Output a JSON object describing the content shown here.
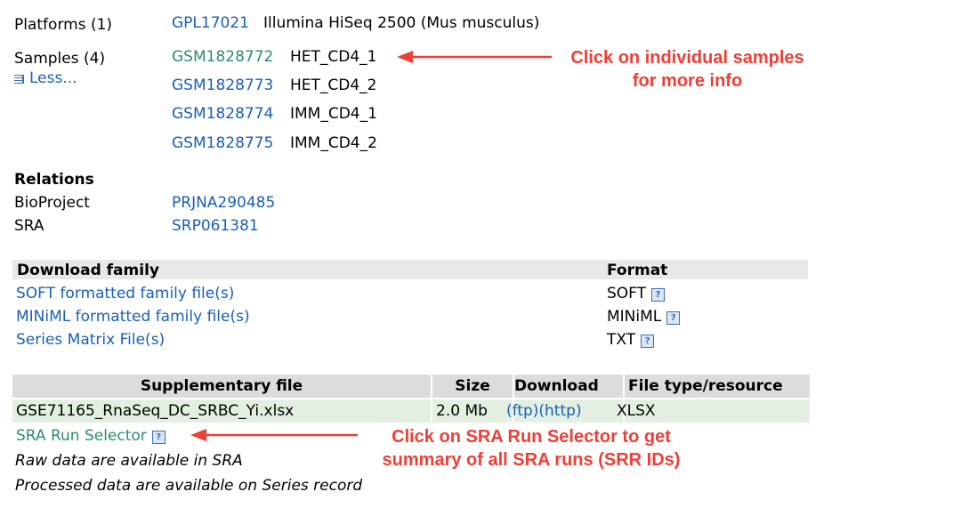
{
  "platforms": {
    "label": "Platforms (1)",
    "id": "GPL17021",
    "desc": "Illumina HiSeq 2500 (Mus musculus)"
  },
  "samples": {
    "label": "Samples (4)",
    "less": "Less...",
    "items": [
      {
        "id": "GSM1828772",
        "name": "HET_CD4_1"
      },
      {
        "id": "GSM1828773",
        "name": "HET_CD4_2"
      },
      {
        "id": "GSM1828774",
        "name": "IMM_CD4_1"
      },
      {
        "id": "GSM1828775",
        "name": "IMM_CD4_2"
      }
    ]
  },
  "relations": {
    "heading": "Relations",
    "bioproject_label": "BioProject",
    "bioproject_id": "PRJNA290485",
    "sra_label": "SRA",
    "sra_id": "SRP061381"
  },
  "download_family": {
    "header": "Download family",
    "format_header": "Format",
    "rows": [
      {
        "label": "SOFT formatted family file(s)",
        "format": "SOFT"
      },
      {
        "label": "MINiML formatted family file(s)",
        "format": "MINiML"
      },
      {
        "label": "Series Matrix File(s)",
        "format": "TXT"
      }
    ]
  },
  "supplementary": {
    "headers": [
      "Supplementary file",
      "Size",
      "Download",
      "File type/resource"
    ],
    "row": {
      "file": "GSE71165_RnaSeq_DC_SRBC_Yi.xlsx",
      "size": "2.0 Mb",
      "ftp": "(ftp)",
      "http": "(http)",
      "type": "XLSX"
    },
    "sra_run_selector": "SRA Run Selector",
    "raw_note": "Raw data are available in SRA",
    "processed_note": "Processed data are available on Series record"
  },
  "help_icon": {
    "glyph": "?",
    "name": "help-icon"
  },
  "annotations": {
    "samples_line1": "Click on individual samples",
    "samples_line2": "for more info",
    "sra_line1": "Click on SRA Run Selector to get",
    "sra_line2": "summary of all SRA runs (SRR IDs)",
    "color": "#ef3e36"
  }
}
